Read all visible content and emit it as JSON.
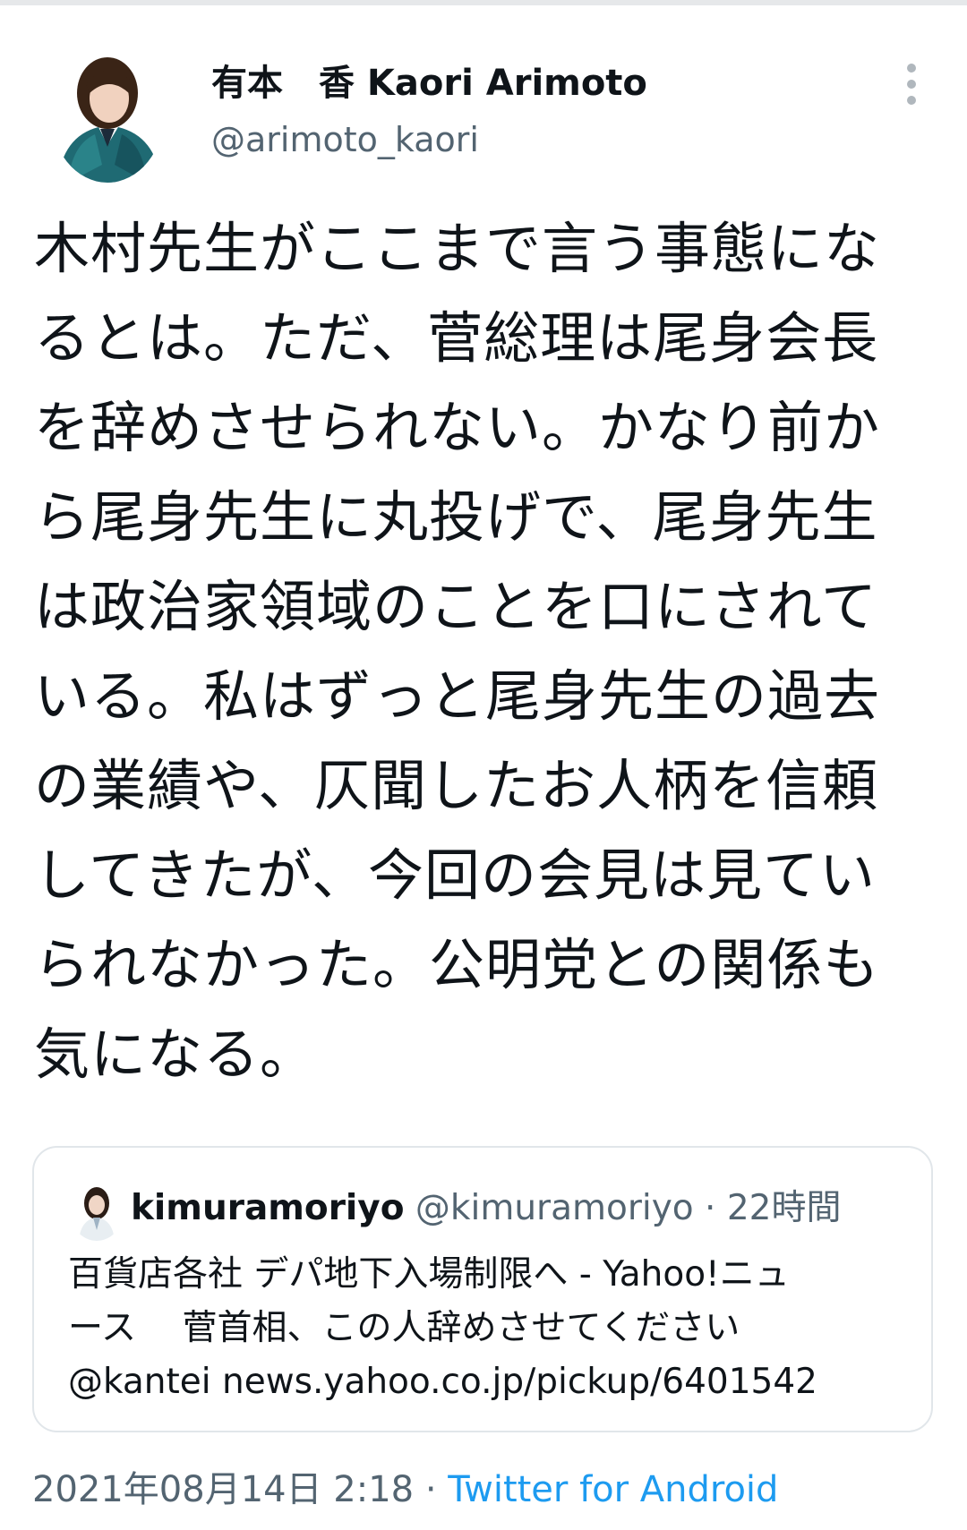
{
  "author": {
    "display_name": "有本　香  Kaori Arimoto",
    "handle": "@arimoto_kaori"
  },
  "tweet": {
    "lines": [
      "木村先生がここまで言う事態にな",
      "るとは。ただ、菅総理は尾身会長",
      "を辞めさせられない。かなり前か",
      "ら尾身先生に丸投げで、尾身先生",
      "は政治家領域のことを口にされて",
      "いる。私はずっと尾身先生の過去",
      "の業績や、仄聞したお人柄を信頼",
      "してきたが、今回の会見は見てい",
      "られなかった。公明党との関係も",
      "気になる。"
    ]
  },
  "quoted_tweet": {
    "name": "kimuramoriyo",
    "handle": "@kimuramoriyo",
    "separator": " · ",
    "time": "22時間",
    "lines": [
      "百貨店各社 デパ地下入場制限へ - Yahoo!ニュ",
      "ース　 菅首相、この人辞めさせてください",
      "@kantei  news.yahoo.co.jp/pickup/6401542"
    ]
  },
  "footer": {
    "timestamp": "2021年08月14日 2:18",
    "separator": " · ",
    "source": "Twitter for Android"
  },
  "colors": {
    "text_primary": "#0f1419",
    "text_secondary": "#536471",
    "link": "#1d9bf0",
    "border": "#e1e6ea"
  },
  "icons": {
    "more": "more-vertical-icon"
  }
}
